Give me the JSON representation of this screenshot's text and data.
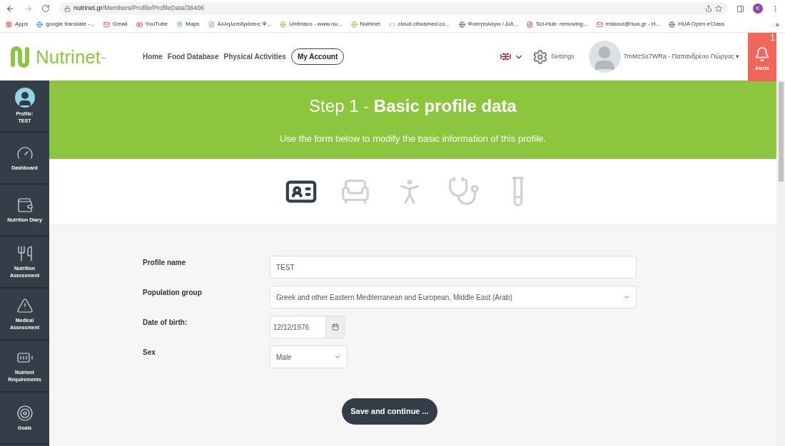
{
  "browser": {
    "url_host": "nutrinet.gr",
    "url_path": "/Members/Profile/ProfileData/38406",
    "profile_initial": "K",
    "bookmarks": [
      {
        "label": "Apps",
        "kind": "apps"
      },
      {
        "label": "google translate -...",
        "kind": "google"
      },
      {
        "label": "Gmail",
        "kind": "gmail"
      },
      {
        "label": "YouTube",
        "kind": "youtube"
      },
      {
        "label": "Maps",
        "kind": "maps"
      },
      {
        "label": "Αλληλεπιδράσεις Φ...",
        "kind": "doc"
      },
      {
        "label": "Umbraco - www.nu...",
        "kind": "nutrinet"
      },
      {
        "label": "Nutrinet",
        "kind": "nutrinet"
      },
      {
        "label": "cloud.cibusmed.co...",
        "kind": "code"
      },
      {
        "label": "Φοιτητολόγιο / Διδ...",
        "kind": "globe"
      },
      {
        "label": "Sci-Hub: removing...",
        "kind": "scihub"
      },
      {
        "label": "mskour@hua.gr - H...",
        "kind": "gmail"
      },
      {
        "label": "HUA Open eClass",
        "kind": "eclass"
      }
    ],
    "more": "»"
  },
  "header": {
    "logo": "Nutrinet",
    "logo_mark": "™",
    "nav": [
      {
        "label": "Home",
        "selected": false
      },
      {
        "label": "Food Database",
        "selected": false
      },
      {
        "label": "Physical Activities",
        "selected": false
      },
      {
        "label": "My Account",
        "selected": true
      }
    ],
    "settings": "Settings",
    "user": "7mMzSs7WRa - Παπανδρέου Γιώργος",
    "user_caret": "▾",
    "alerts_label": "Alerts",
    "alerts_count": "1"
  },
  "sidebar": [
    {
      "label": "Profile:\nTEST",
      "kind": "profile"
    },
    {
      "label": "Dashboard",
      "kind": "dashboard"
    },
    {
      "label": "Nutrition Diary",
      "kind": "diary"
    },
    {
      "label": "Nutrition\nAssessment",
      "kind": "plate"
    },
    {
      "label": "Medical\nAssessment",
      "kind": "warning"
    },
    {
      "label": "Nutrient\nRequirements",
      "kind": "battery"
    },
    {
      "label": "Goals",
      "kind": "target"
    }
  ],
  "banner": {
    "title": "Step 1 - ",
    "title_bold": "Basic profile data",
    "subtitle": "Use the form below to modify the basic information of this profile."
  },
  "steps": [
    {
      "kind": "id-card",
      "selected": true
    },
    {
      "kind": "activities",
      "selected": false
    },
    {
      "kind": "body",
      "selected": false
    },
    {
      "kind": "medical",
      "selected": false
    },
    {
      "kind": "tube",
      "selected": false
    }
  ],
  "form": [
    {
      "label": "Profile name",
      "kind": "text",
      "value": "TEST"
    },
    {
      "label": "Population group",
      "kind": "select",
      "value": "Greek and other Eastern Mediterranean and European, Middle East (Arab)"
    },
    {
      "label": "Date of birth:",
      "kind": "date",
      "value": "12/12/1976"
    },
    {
      "label": "Sex",
      "kind": "select-small",
      "value": "Male"
    }
  ],
  "save_button": "Save and continue ..."
}
